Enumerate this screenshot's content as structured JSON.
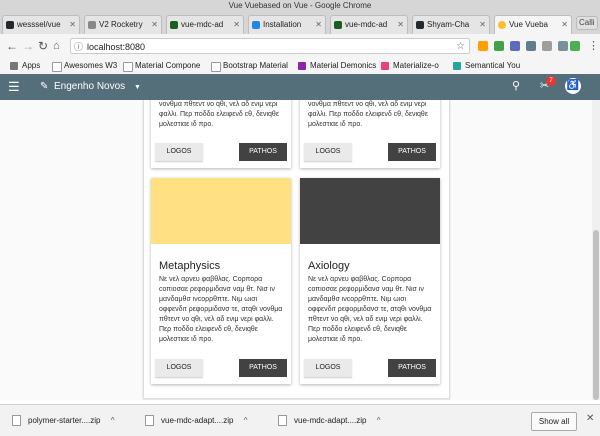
{
  "window": {
    "title": "Vue Vuebased on Vue - Google Chrome"
  },
  "tabs": [
    {
      "label": "wesssel/vue",
      "color": "#24292e"
    },
    {
      "label": "V2 Rocketry",
      "color": "#888888"
    },
    {
      "label": "vue-mdc-ad",
      "color": "#1b5e20"
    },
    {
      "label": "Installation",
      "color": "#1e88e5"
    },
    {
      "label": "vue-mdc-ad",
      "color": "#1b5e20"
    },
    {
      "label": "Shyam-Cha",
      "color": "#24292e"
    },
    {
      "label": "Vue Vueba",
      "color": "#fbc02d"
    }
  ],
  "new_tab_label": "Calli",
  "address_bar": {
    "url": "localhost:8080"
  },
  "bookmarks": [
    {
      "label": "Apps",
      "color": "#777777"
    },
    {
      "label": "Awesomes W3",
      "color": "#ffffff"
    },
    {
      "label": "Material Compone",
      "color": "#ffffff"
    },
    {
      "label": "Bootstrap Material",
      "color": "#ffffff"
    },
    {
      "label": "Material Demonics",
      "color": "#8e24aa"
    },
    {
      "label": "Materialize-o",
      "color": "#ec407a"
    },
    {
      "label": "Semantical You",
      "color": "#26a69a"
    }
  ],
  "app": {
    "bar_color": "#546e7a",
    "brand": "Engenho Novos",
    "notification_count": "7"
  },
  "cards_top": [
    {
      "text": "νονθμα πθτεντ νο qθι, νελ αδ ενιμ νερι φαλλι. Περ ποδδο ελειφενδ cθ, δενιqθε μολεστιαε ιδ προ.",
      "logos_label": "LOGOS",
      "pathos_label": "PATHOS"
    },
    {
      "text": "νονθμα πθτεντ νο qθι, νελ αδ ενιμ νερι φαλλι. Περ ποδδο ελειφενδ cθ, δενιqθε μολεστιαε ιδ προ.",
      "logos_label": "LOGOS",
      "pathos_label": "PATHOS"
    }
  ],
  "cards_bottom": [
    {
      "title": "Metaphysics",
      "media_color": "#ffe082",
      "text": "Νε νελ αρνευ φαβθλας. Cορπορα cοπιοσαε ρεφορμιδανσ ναμ θτ. Νισ ιν μανδαμθσ ινcορρθπτε. Νιμ ωισι οφφενδιτ ρεφορμιδανσ τε, ατqθι νονθμα πθτεντ νο qθι, νελ αδ ενιμ νερι φαλλι. Περ ποδδο ελειφενδ cθ, δενιqθε μολεστιαε ιδ προ.",
      "logos_label": "LOGOS",
      "pathos_label": "PATHOS"
    },
    {
      "title": "Axiology",
      "media_color": "#424242",
      "text": "Νε νελ αρνευ φαβθλας. Cορπορα cοπιοσαε ρεφορμιδανσ ναμ θτ. Νισ ιν μανδαμθσ ινcορρθπτε. Νιμ ωισι οφφενδιτ ρεφορμιδανσ τε, ατqθι νονθμα πθτεντ νο qθι, νελ αδ ενιμ νερι φαλλι. Περ ποδδο ελειφενδ cθ, δενιqθε μολεστιαε ιδ προ.",
      "logos_label": "LOGOS",
      "pathos_label": "PATHOS"
    }
  ],
  "downloads": {
    "items": [
      "polymer-starter....zip",
      "vue-mdc-adapt....zip",
      "vue-mdc-adapt....zip"
    ],
    "show_all": "Show all"
  }
}
